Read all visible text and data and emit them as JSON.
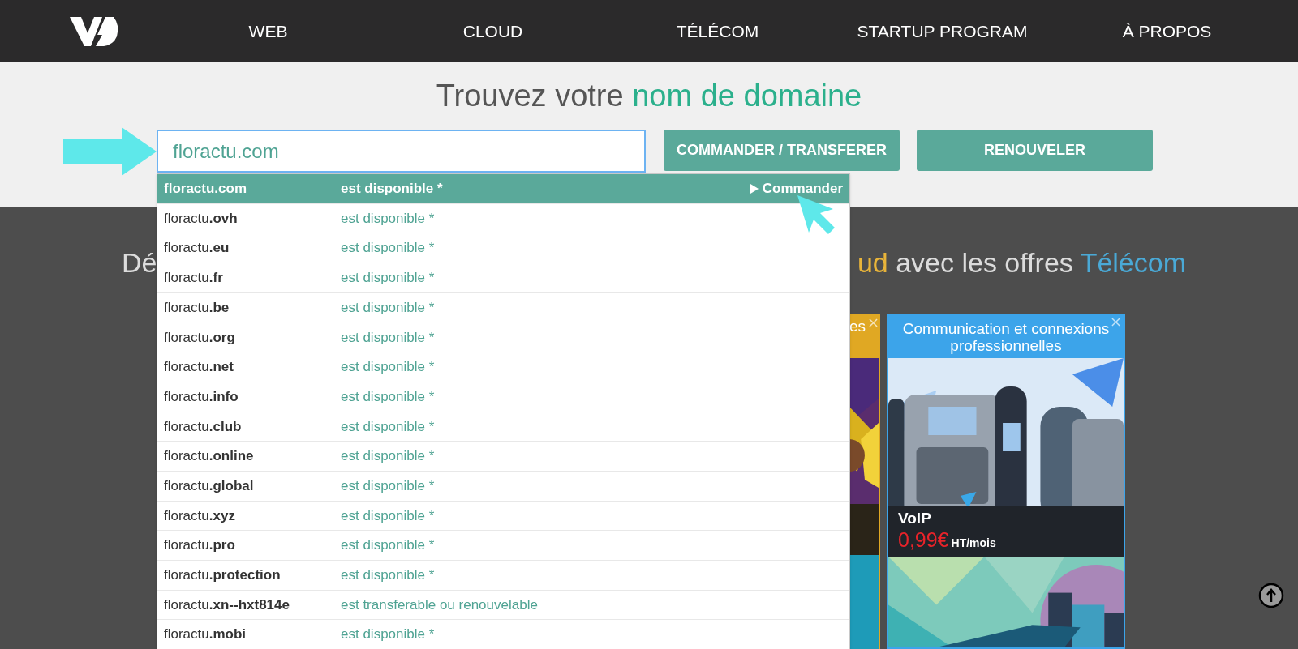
{
  "nav": {
    "items": [
      "WEB",
      "CLOUD",
      "TÉLÉCOM",
      "STARTUP PROGRAM",
      "À PROPOS"
    ]
  },
  "search": {
    "title": "Trouvez votre ",
    "title_highlight": "nom de domaine",
    "value": "floractu.com",
    "buttons": [
      "COMMANDER / TRANSFERER",
      "RENOUVELER"
    ]
  },
  "suggestions": [
    {
      "name": "floractu",
      "tld": ".com",
      "status": "est disponible *",
      "selected": true,
      "action": "Commander"
    },
    {
      "name": "floractu",
      "tld": ".ovh",
      "status": "est disponible *",
      "selected": false
    },
    {
      "name": "floractu",
      "tld": ".eu",
      "status": "est disponible *",
      "selected": false
    },
    {
      "name": "floractu",
      "tld": ".fr",
      "status": "est disponible *",
      "selected": false
    },
    {
      "name": "floractu",
      "tld": ".be",
      "status": "est disponible *",
      "selected": false
    },
    {
      "name": "floractu",
      "tld": ".org",
      "status": "est disponible *",
      "selected": false
    },
    {
      "name": "floractu",
      "tld": ".net",
      "status": "est disponible *",
      "selected": false
    },
    {
      "name": "floractu",
      "tld": ".info",
      "status": "est disponible *",
      "selected": false
    },
    {
      "name": "floractu",
      "tld": ".club",
      "status": "est disponible *",
      "selected": false
    },
    {
      "name": "floractu",
      "tld": ".online",
      "status": "est disponible *",
      "selected": false
    },
    {
      "name": "floractu",
      "tld": ".global",
      "status": "est disponible *",
      "selected": false
    },
    {
      "name": "floractu",
      "tld": ".xyz",
      "status": "est disponible *",
      "selected": false
    },
    {
      "name": "floractu",
      "tld": ".pro",
      "status": "est disponible *",
      "selected": false
    },
    {
      "name": "floractu",
      "tld": ".protection",
      "status": "est disponible *",
      "selected": false
    },
    {
      "name": "floractu",
      "tld": ".xn--hxt814e",
      "status": "est transferable ou renouvelable",
      "selected": false
    },
    {
      "name": "floractu",
      "tld": ".mobi",
      "status": "est disponible *",
      "selected": false
    }
  ],
  "headline": {
    "start": "Dé",
    "parts": [
      {
        "text": "ud",
        "kind": "cloud"
      },
      {
        "text": " avec les offres ",
        "kind": "plain"
      },
      {
        "text": "Télécom",
        "kind": "telecom"
      }
    ]
  },
  "cards": [
    {
      "kind": "partial",
      "title": "es",
      "closable": true
    },
    {
      "kind": "full",
      "title": "Communication et connexions professionnelles",
      "closable": true,
      "product": "VoIP",
      "price": "0,99€",
      "price_unit": "HT/mois"
    }
  ]
}
